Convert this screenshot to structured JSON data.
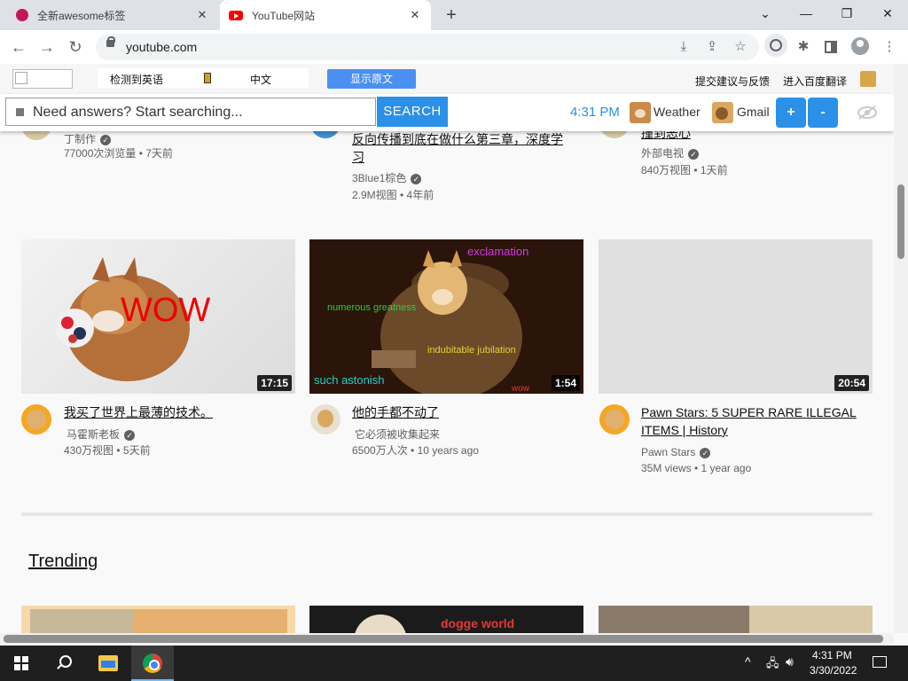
{
  "browser": {
    "tabs": [
      {
        "title": "全新awesome标签",
        "active": false
      },
      {
        "title": "YouTube网站",
        "active": true
      }
    ],
    "url": "youtube.com"
  },
  "translate_bar": {
    "detected": "检测到英语",
    "target": "中文",
    "show_original": "显示原文",
    "feedback": "提交建议与反馈",
    "open_baidu": "进入百度翻译"
  },
  "search_ext": {
    "placeholder": "Need answers? Start searching...",
    "search_button": "SEARCH",
    "time": "4:31 PM",
    "weather": "Weather",
    "gmail": "Gmail",
    "plus": "+",
    "minus": "-"
  },
  "videos_top": [
    {
      "title": "",
      "channel": "丁制作",
      "meta": "77000次浏览量 • 7天前"
    },
    {
      "title": "反向传播到底在做什么第三章，深度学习",
      "channel": "3Blue1棕色",
      "meta": "2.9M视图 • 4年前"
    },
    {
      "title": "撞到恶心",
      "channel": "外部电视",
      "meta": "840万视图 • 1天前"
    }
  ],
  "videos_row2": [
    {
      "title": "我买了世界上最薄的技术。",
      "channel": "马霍斯老板",
      "meta": "430万视图 • 5天前",
      "duration": "17:15",
      "overlay": "WOW"
    },
    {
      "title": "他的手都不动了",
      "channel": "它必须被收集起来",
      "meta": "6500万人次 • 10 years ago",
      "duration": "1:54",
      "overlay_words": {
        "w1": "exclamation",
        "w2": "numerous greatness",
        "w3": "indubitable jubilation",
        "w4": "such astonish",
        "w5": "wow"
      }
    },
    {
      "title": "Pawn Stars: 5 SUPER RARE ILLEGAL ITEMS | History",
      "channel": "Pawn Stars",
      "meta": "35M views • 1 year ago",
      "duration": "20:54"
    }
  ],
  "trending": {
    "heading": "Trending",
    "thumb2_text": "dogge world"
  },
  "taskbar": {
    "time": "4:31 PM",
    "date": "3/30/2022"
  },
  "colors": {
    "accent_blue": "#2b90e8",
    "chrome_tabstrip": "#dee1e6",
    "taskbar": "#1f1f1f",
    "youtube_red": "#ff0000"
  }
}
